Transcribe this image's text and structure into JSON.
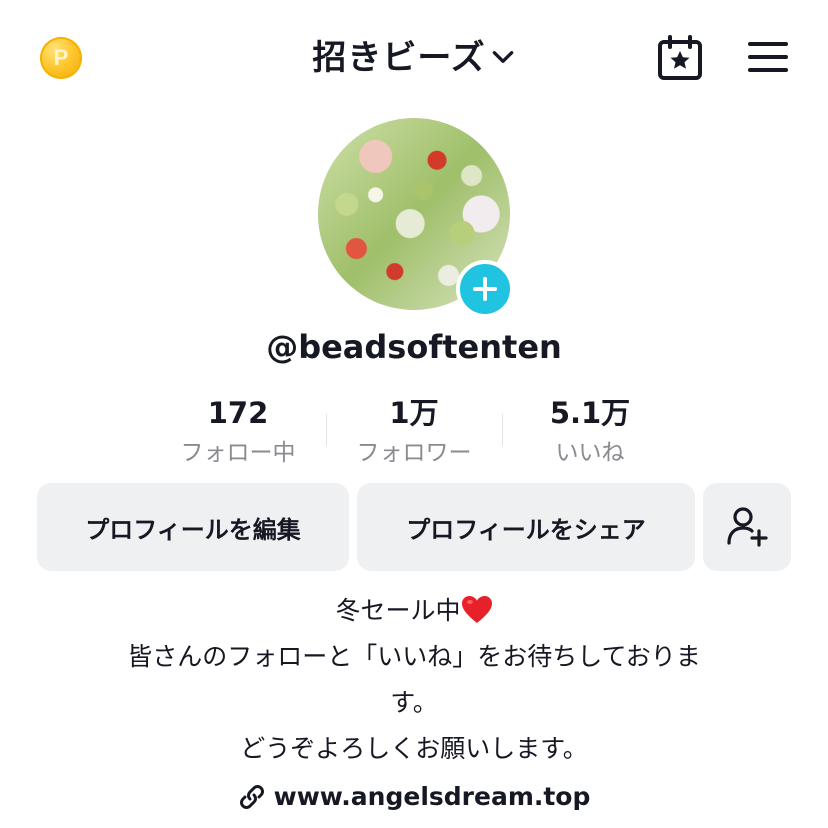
{
  "header": {
    "coin_letter": "P",
    "title": "招きビーズ",
    "coin_icon": "points-coin-icon",
    "calendar_icon": "calendar-star-icon",
    "menu_icon": "hamburger-menu-icon"
  },
  "profile": {
    "username": "@beadsoftenten",
    "add_icon": "plus-icon"
  },
  "stats": [
    {
      "value": "172",
      "label": "フォロー中"
    },
    {
      "value": "1万",
      "label": "フォロワー"
    },
    {
      "value": "5.1万",
      "label": "いいね"
    }
  ],
  "buttons": {
    "edit_profile": "プロフィールを編集",
    "share_profile": "プロフィールをシェア",
    "add_friend_icon": "add-person-icon"
  },
  "bio": {
    "line1": "冬セール中",
    "line2": "皆さんのフォローと「いいね」をお待ちしておりま",
    "line3": "す。",
    "line4": "どうぞよろしくお願いします。",
    "heart_icon": "red-heart-emoji"
  },
  "link": {
    "url": "www.angelsdream.top",
    "icon": "link-icon"
  },
  "colors": {
    "accent": "#20c4e0",
    "coin": "#ffc62e",
    "button_bg": "#eff0f2",
    "muted_text": "#8a8b91"
  }
}
